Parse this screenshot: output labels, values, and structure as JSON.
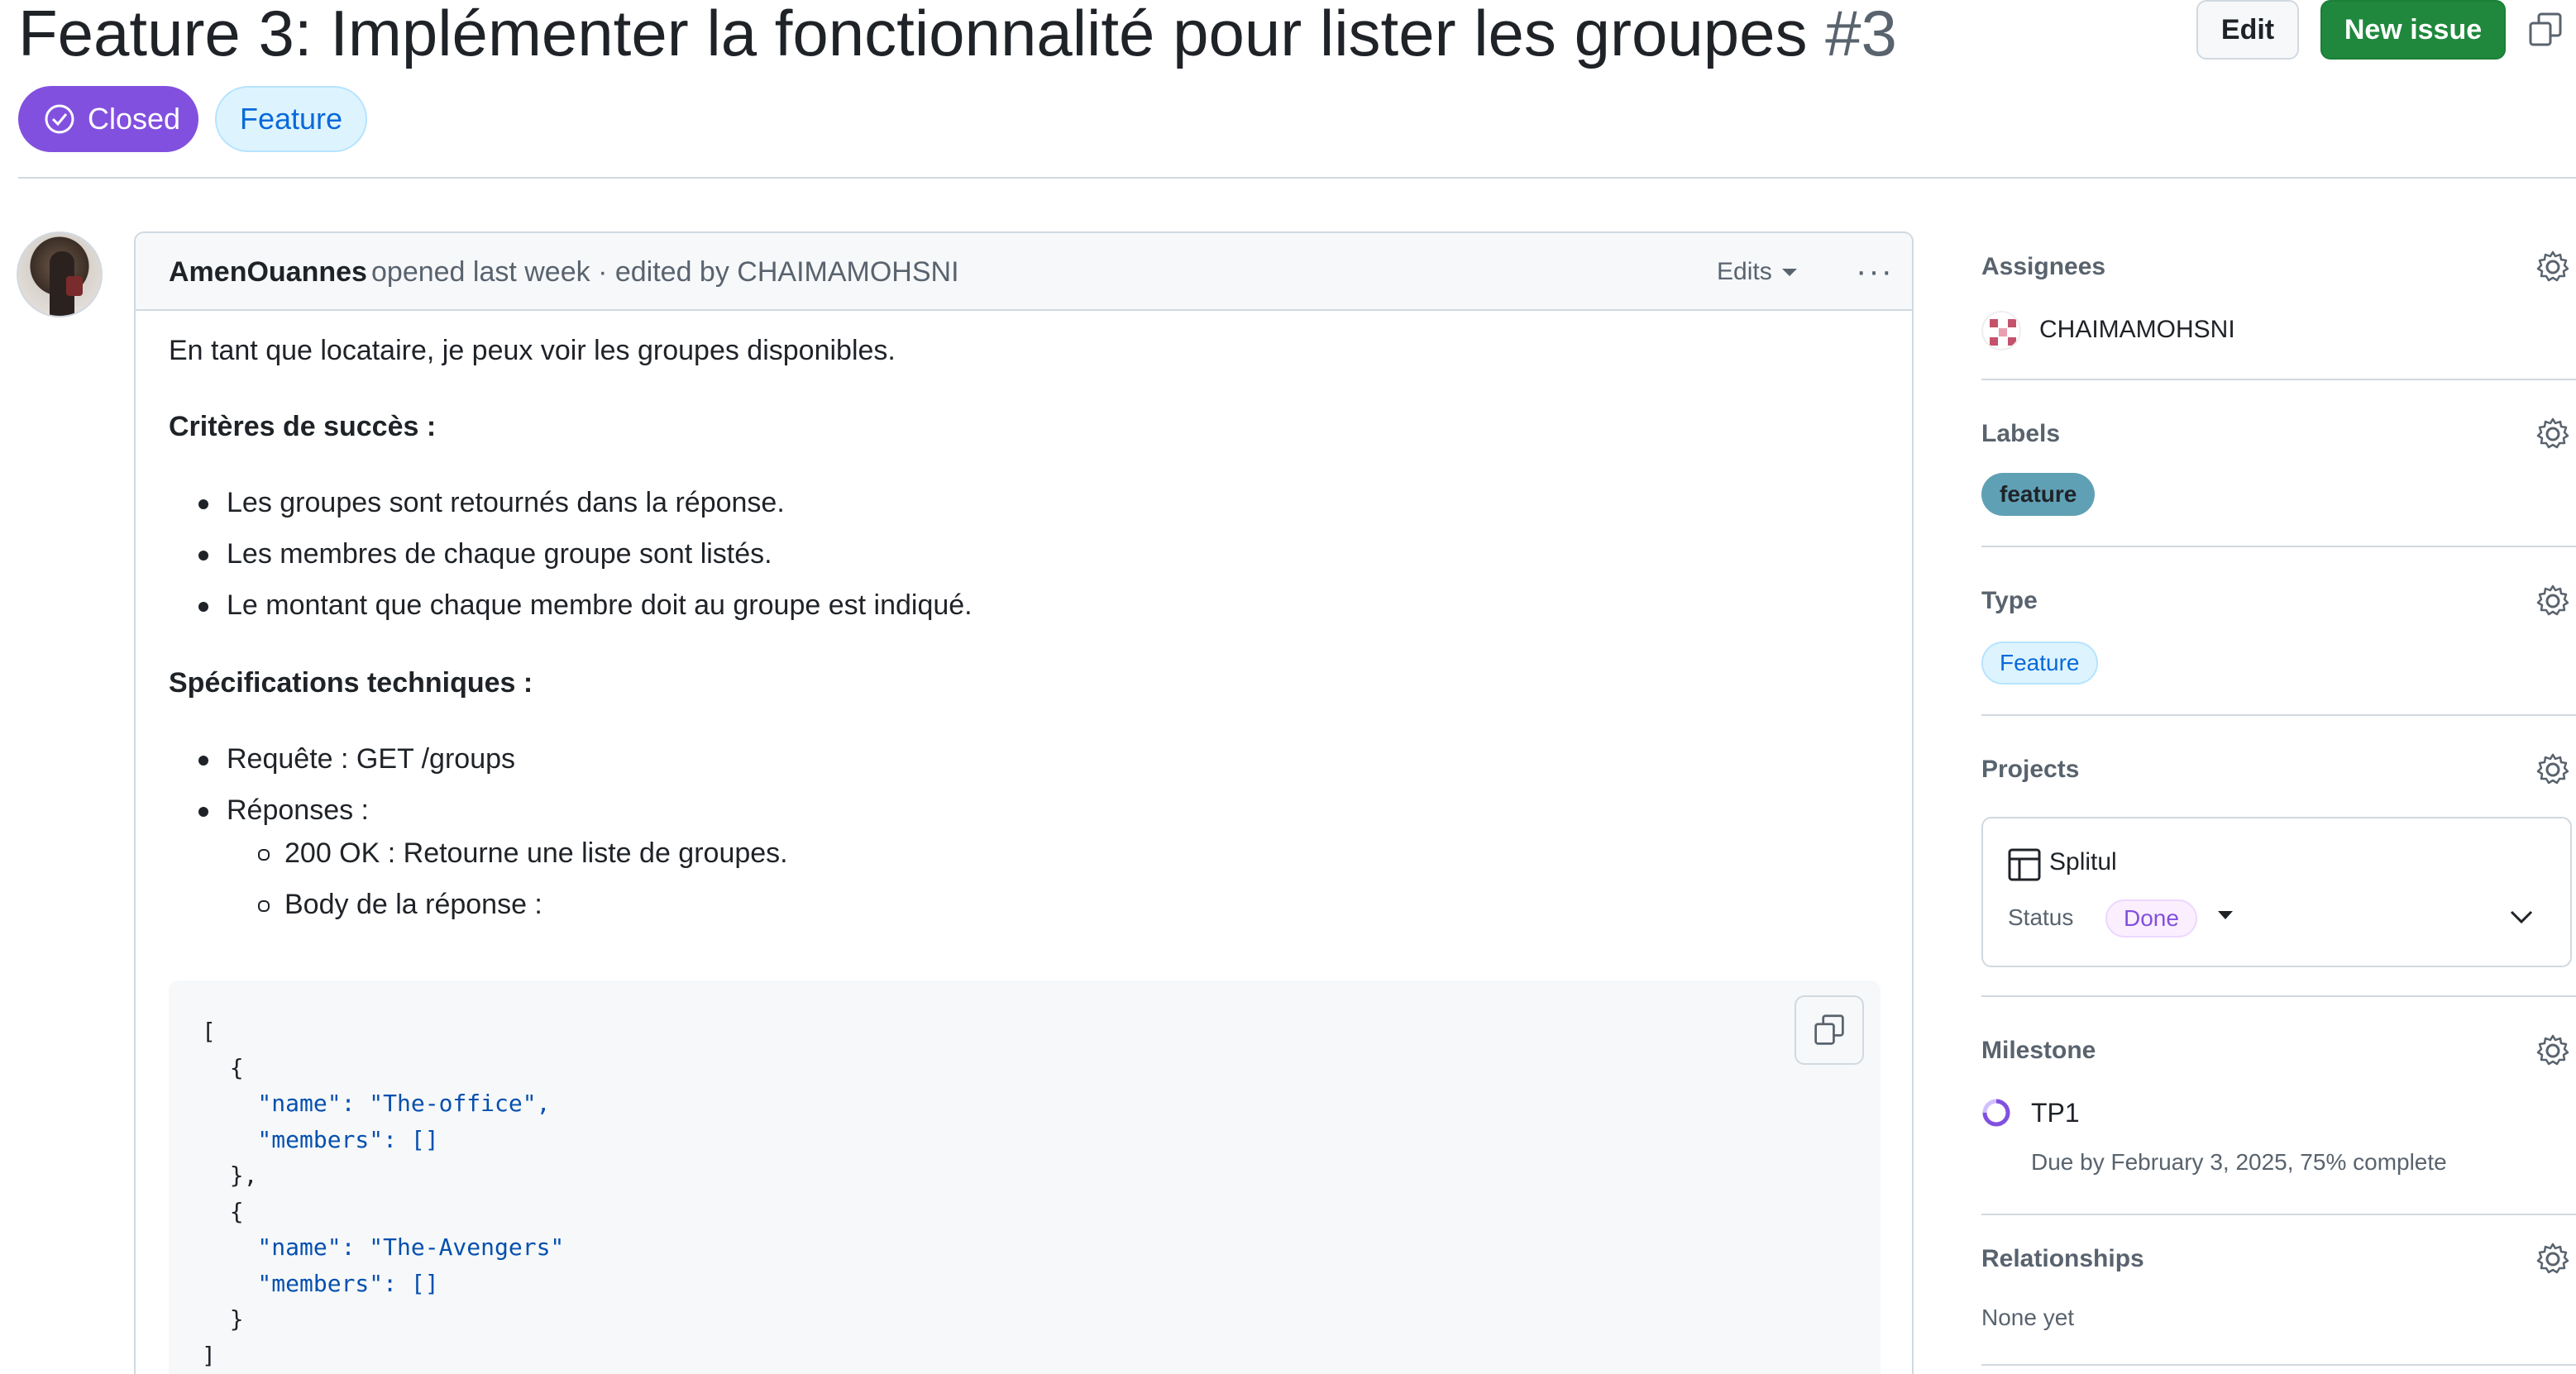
{
  "issue": {
    "title": "Feature 3: Implémenter la fonctionnalité pour lister les groupes",
    "number": "#3",
    "state": "Closed",
    "type": "Feature"
  },
  "header_actions": {
    "edit_label": "Edit",
    "new_issue_label": "New issue"
  },
  "comment": {
    "author": "AmenOuannes",
    "meta": "opened last week · edited by CHAIMAMOHSNI",
    "edits_label": "Edits",
    "more_label": "···",
    "intro": "En tant que locataire, je peux voir les groupes disponibles.",
    "criteria_heading": "Critères de succès :",
    "criteria": [
      "Les groupes sont retournés dans la réponse.",
      "Les membres de chaque groupe sont listés.",
      "Le montant que chaque membre doit au groupe est indiqué."
    ],
    "specs_heading": "Spécifications techniques :",
    "specs": [
      "Requête : GET /groups",
      "Réponses :"
    ],
    "responses": [
      "200 OK : Retourne une liste de groupes.",
      "Body de la réponse :"
    ],
    "code_lines": [
      "[",
      "  {",
      "    \"name\": \"The-office\",",
      "    \"members\": []",
      "  },",
      "  {",
      "    \"name\": \"The-Avengers\"",
      "    \"members\": []",
      "  }",
      "]"
    ]
  },
  "sidebar": {
    "assignees": {
      "title": "Assignees",
      "name": "CHAIMAMOHSNI"
    },
    "labels": {
      "title": "Labels",
      "items": [
        "feature"
      ]
    },
    "type": {
      "title": "Type",
      "value": "Feature"
    },
    "projects": {
      "title": "Projects",
      "name": "Splitul",
      "status_label": "Status",
      "status_value": "Done"
    },
    "milestone": {
      "title": "Milestone",
      "name": "TP1",
      "due": "Due by February 3, 2025, 75% complete",
      "progress_fraction": 0.75
    },
    "relationships": {
      "title": "Relationships",
      "value": "None yet"
    }
  },
  "colors": {
    "closed_badge": "#8250df",
    "new_issue_button": "#1f883d",
    "label_feature": "#5fa0b5",
    "link_blue": "#0969da"
  }
}
